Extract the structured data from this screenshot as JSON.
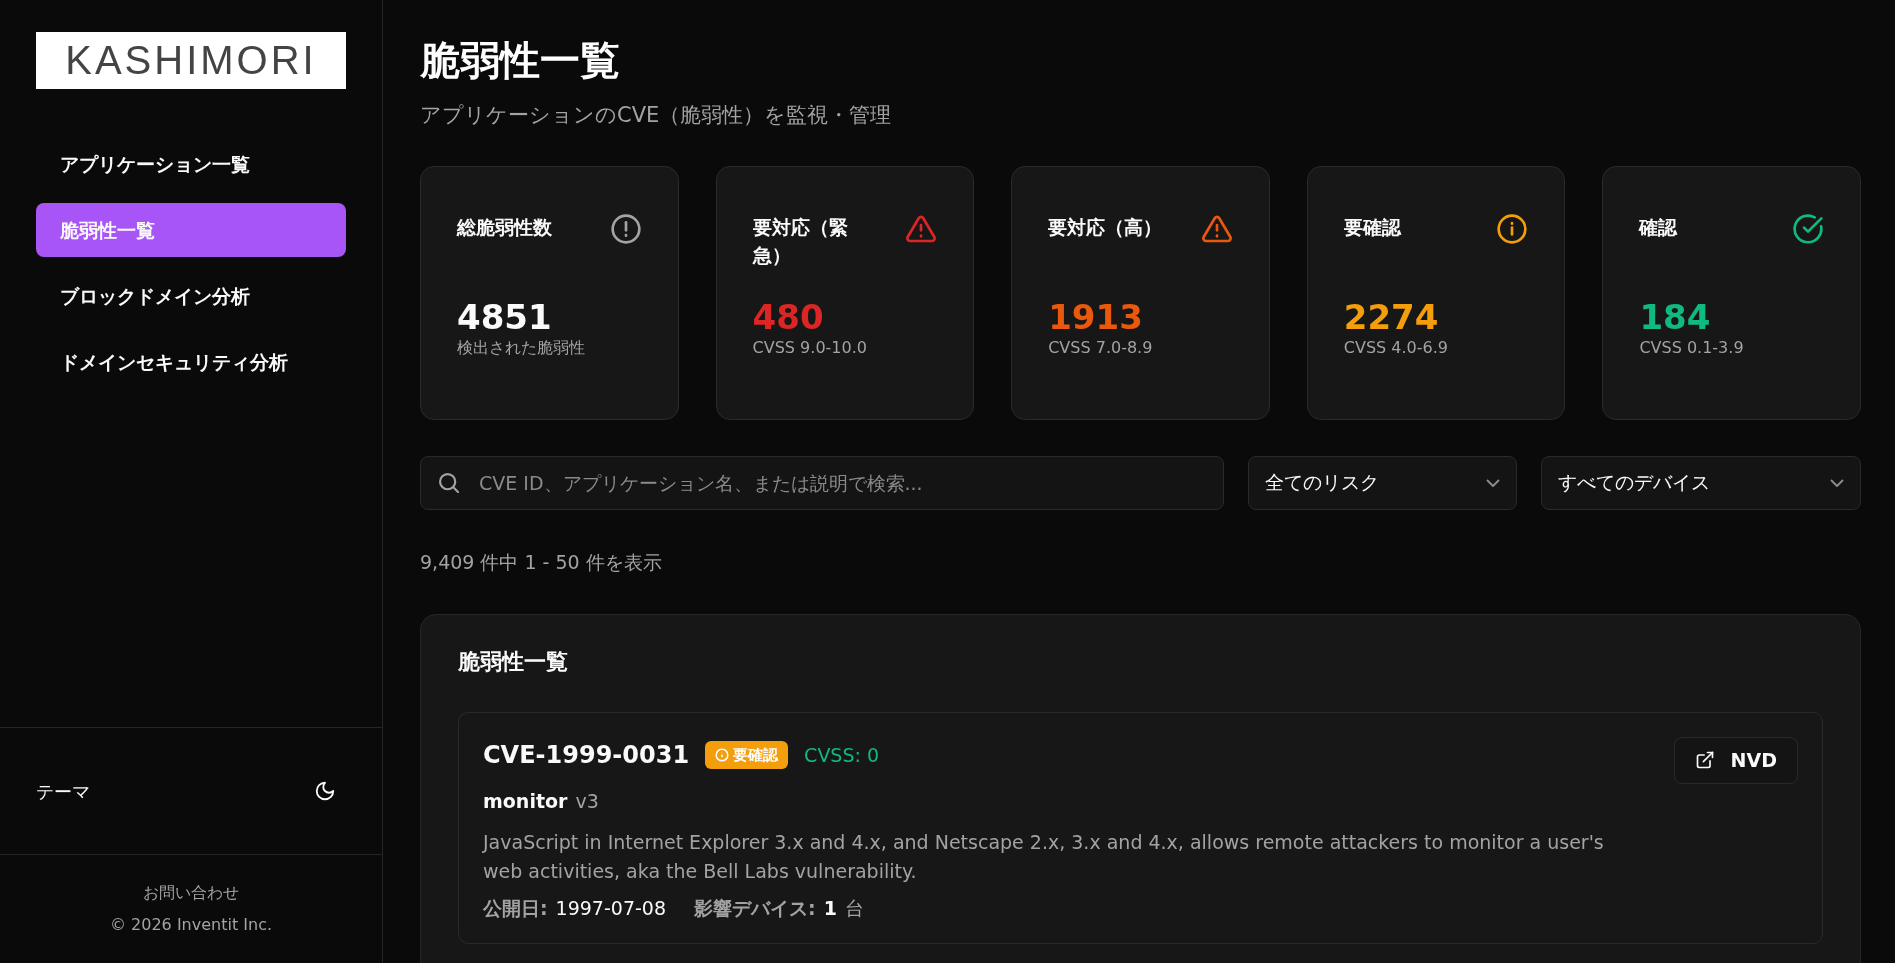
{
  "sidebar": {
    "logo": "KASHIMORI",
    "items": [
      {
        "label": "アプリケーション一覧",
        "selected": false
      },
      {
        "label": "脆弱性一覧",
        "selected": true
      },
      {
        "label": "ブロックドメイン分析",
        "selected": false
      },
      {
        "label": "ドメインセキュリティ分析",
        "selected": false
      }
    ],
    "theme_label": "テーマ",
    "contact": "お問い合わせ",
    "copyright": "© 2026 Inventit Inc."
  },
  "header": {
    "title": "脆弱性一覧",
    "subtitle": "アプリケーションのCVE（脆弱性）を監視・管理"
  },
  "stats": [
    {
      "kind": "total",
      "title": "総脆弱性数",
      "value": "4851",
      "caption": "検出された脆弱性",
      "color": "#a3a3a3"
    },
    {
      "kind": "critical",
      "title": "要対応（緊急）",
      "value": "480",
      "caption": "CVSS 9.0-10.0",
      "color": "#dc2626"
    },
    {
      "kind": "high",
      "title": "要対応（高）",
      "value": "1913",
      "caption": "CVSS 7.0-8.9",
      "color": "#ea580c"
    },
    {
      "kind": "medium",
      "title": "要確認",
      "value": "2274",
      "caption": "CVSS 4.0-6.9",
      "color": "#f59e0b"
    },
    {
      "kind": "low",
      "title": "確認",
      "value": "184",
      "caption": "CVSS 0.1-3.9",
      "color": "#10b981"
    }
  ],
  "filters": {
    "search": {
      "placeholder": "CVE ID、アプリケーション名、または説明で検索..."
    },
    "risk": "全てのリスク",
    "device": "すべてのデバイス"
  },
  "result_count": "9,409 件中 1 - 50 件を表示",
  "list": {
    "title": "脆弱性一覧",
    "items": [
      {
        "cve": "CVE-1999-0031",
        "badge": {
          "label": "要確認",
          "color": "#f59e0b"
        },
        "cvss": {
          "label": "CVSS: 0",
          "color": "#10b981"
        },
        "app": "monitor",
        "version": "v3",
        "description": "JavaScript in Internet Explorer 3.x and 4.x, and Netscape 2.x, 3.x and 4.x, allows remote attackers to monitor a user's web activities, aka the Bell Labs vulnerability.",
        "published_label": "公開日:",
        "published": "1997-07-08",
        "devices_label": "影響デバイス:",
        "devices": "1",
        "devices_unit": "台",
        "link": "NVD"
      }
    ]
  }
}
